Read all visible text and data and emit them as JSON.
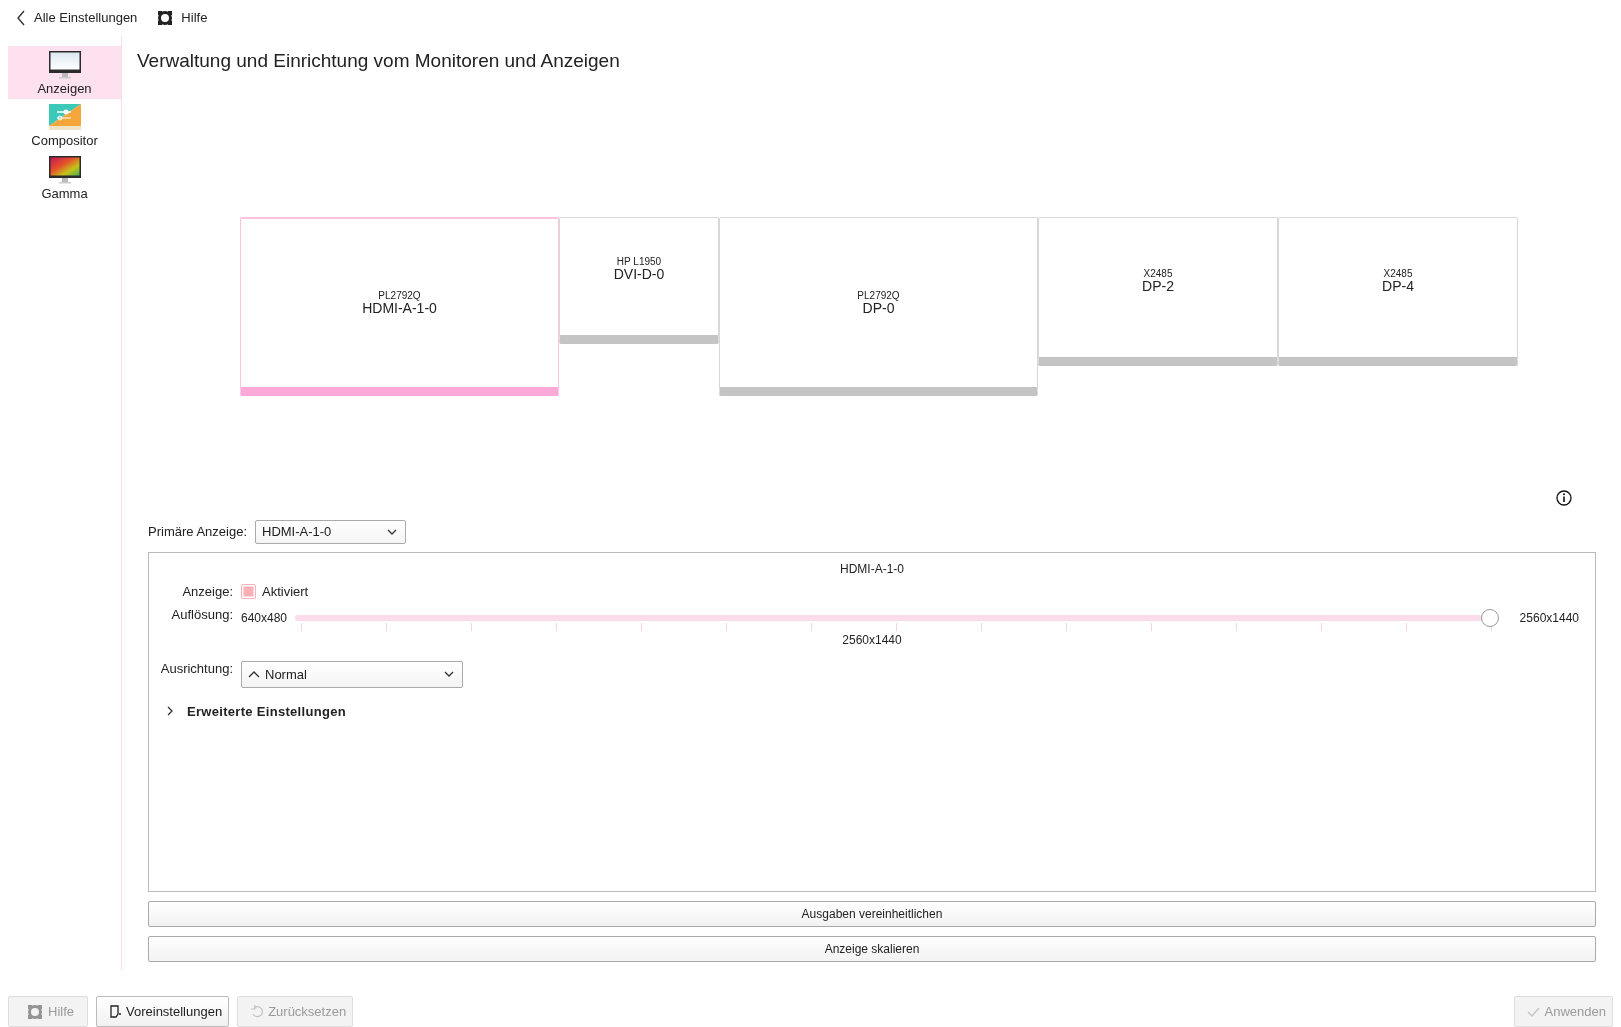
{
  "topbar": {
    "back": "Alle Einstellungen",
    "help": "Hilfe"
  },
  "sidebar": {
    "items": [
      {
        "kind": "display",
        "label": "Anzeigen",
        "selected": true
      },
      {
        "kind": "compositor",
        "label": "Compositor",
        "selected": false
      },
      {
        "kind": "gamma",
        "label": "Gamma",
        "selected": false
      }
    ]
  },
  "title": "Verwaltung und Einrichtung vom Monitoren und Anzeigen",
  "monitors": [
    {
      "model": "PL2792Q",
      "output": "HDMI-A-1-0",
      "selected": true
    },
    {
      "model": "HP L1950",
      "output": "DVI-D-0",
      "selected": false
    },
    {
      "model": "PL2792Q",
      "output": "DP-0",
      "selected": false
    },
    {
      "model": "X2485",
      "output": "DP-2",
      "selected": false
    },
    {
      "model": "X2485",
      "output": "DP-4",
      "selected": false
    }
  ],
  "primary": {
    "label": "Primäre Anzeige:",
    "value": "HDMI-A-1-0"
  },
  "output_panel": {
    "title": "HDMI-A-1-0",
    "display_label": "Anzeige:",
    "enabled": {
      "label": "Aktiviert",
      "checked": true
    },
    "resolution_label": "Auflösung:",
    "resolution_min": "640x480",
    "resolution_max": "2560x1440",
    "resolution": {
      "level": 1
    },
    "resolution_current": "2560x1440",
    "orientation_label": "Ausrichtung:",
    "orientation": "Normal",
    "advanced": {
      "label": "Erweiterte Einstellungen",
      "expanded": false
    }
  },
  "actions": [
    "Ausgaben vereinheitlichen",
    "Anzeige skalieren"
  ],
  "footer": [
    {
      "kind": "help",
      "label": "Hilfe",
      "disabled": true
    },
    {
      "kind": "defaults",
      "label": "Voreinstellungen",
      "disabled": false
    },
    {
      "kind": "reset",
      "label": "Zurücksetzen",
      "disabled": true
    },
    {
      "kind": "apply",
      "label": "Anwenden",
      "disabled": true
    }
  ]
}
